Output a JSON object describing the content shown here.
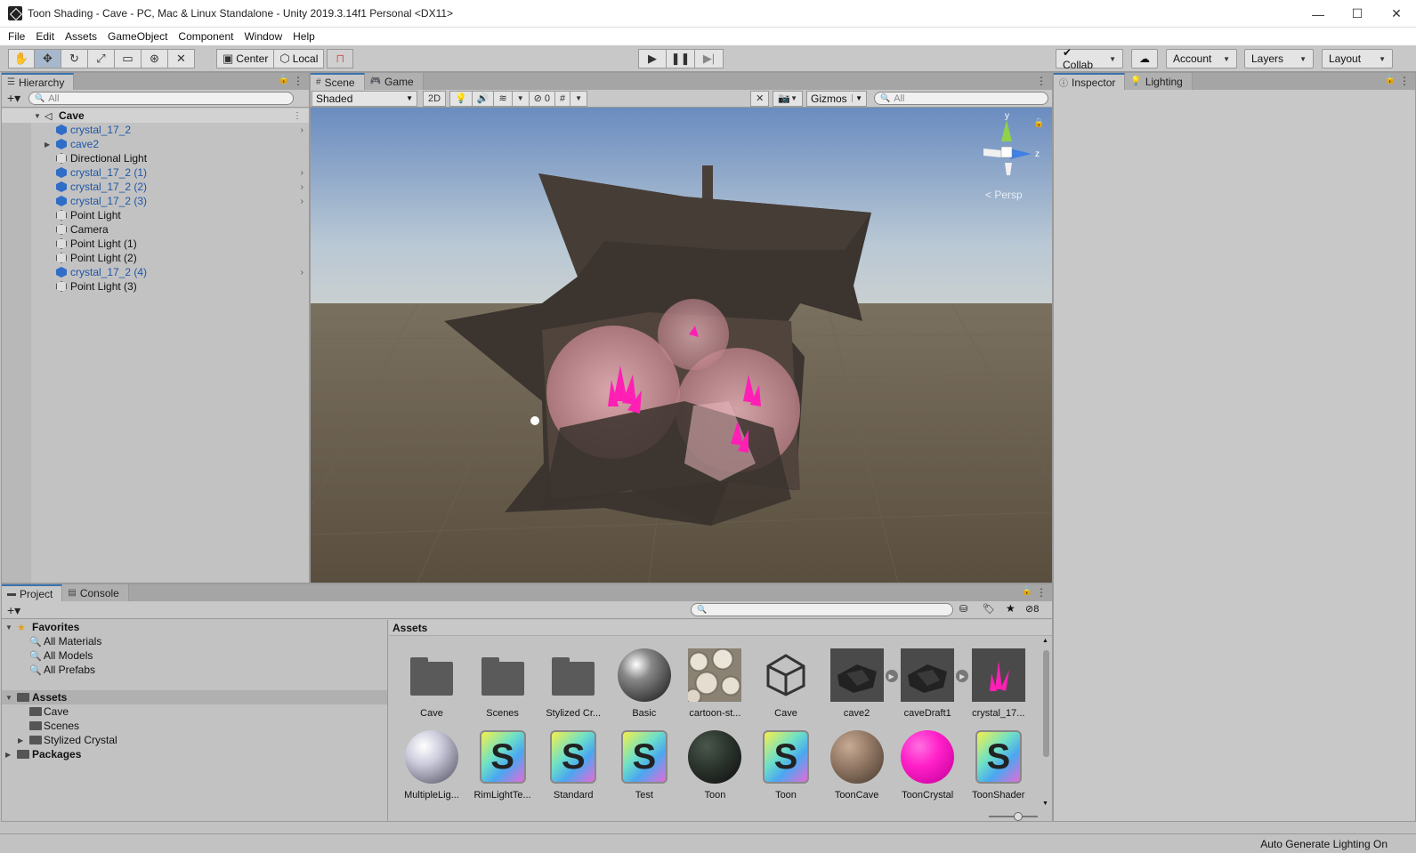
{
  "window": {
    "title": "Toon Shading - Cave - PC, Mac & Linux Standalone - Unity 2019.3.14f1 Personal <DX11>",
    "minimize": "—",
    "maximize": "☐",
    "close": "✕"
  },
  "menu": [
    "File",
    "Edit",
    "Assets",
    "GameObject",
    "Component",
    "Window",
    "Help"
  ],
  "toolbar": {
    "pivot_label": "Center",
    "space_label": "Local",
    "collab_label": "Collab",
    "account_label": "Account",
    "layers_label": "Layers",
    "layout_label": "Layout"
  },
  "hierarchy": {
    "tab_label": "Hierarchy",
    "search_placeholder": "All",
    "scene_name": "Cave",
    "items": [
      {
        "label": "crystal_17_2",
        "style": "prefab",
        "expandable": false,
        "chevron": true
      },
      {
        "label": "cave2",
        "style": "prefab",
        "expandable": true,
        "chevron": false
      },
      {
        "label": "Directional Light",
        "style": "object",
        "expandable": false,
        "chevron": false
      },
      {
        "label": "crystal_17_2 (1)",
        "style": "prefab",
        "expandable": false,
        "chevron": true
      },
      {
        "label": "crystal_17_2 (2)",
        "style": "prefab",
        "expandable": false,
        "chevron": true
      },
      {
        "label": "crystal_17_2 (3)",
        "style": "prefab",
        "expandable": false,
        "chevron": true
      },
      {
        "label": "Point Light",
        "style": "object",
        "expandable": false,
        "chevron": false
      },
      {
        "label": "Camera",
        "style": "object",
        "expandable": false,
        "chevron": false
      },
      {
        "label": "Point Light (1)",
        "style": "object",
        "expandable": false,
        "chevron": false
      },
      {
        "label": "Point Light (2)",
        "style": "object",
        "expandable": false,
        "chevron": false
      },
      {
        "label": "crystal_17_2 (4)",
        "style": "prefab",
        "expandable": false,
        "chevron": true
      },
      {
        "label": "Point Light (3)",
        "style": "object",
        "expandable": false,
        "chevron": false
      }
    ]
  },
  "scene": {
    "tabs": [
      {
        "label": "Scene",
        "icon": "grid-icon"
      },
      {
        "label": "Game",
        "icon": "gamepad-icon"
      }
    ],
    "shading_mode": "Shaded",
    "mode_2d": "2D",
    "hidden_count": "0",
    "gizmos_label": "Gizmos",
    "search_placeholder": "All",
    "gizmo_persp": "Persp",
    "axis_y": "y",
    "axis_z": "z"
  },
  "inspector": {
    "tabs": [
      {
        "label": "Inspector",
        "icon": "info-icon"
      },
      {
        "label": "Lighting",
        "icon": "bulb-icon"
      }
    ]
  },
  "project": {
    "tabs": [
      {
        "label": "Project",
        "icon": "folder-icon"
      },
      {
        "label": "Console",
        "icon": "console-icon"
      }
    ],
    "hidden_count": "8",
    "favorites_label": "Favorites",
    "favorites": [
      "All Materials",
      "All Models",
      "All Prefabs"
    ],
    "assets_label": "Assets",
    "asset_folders": [
      "Cave",
      "Scenes",
      "Stylized Crystal"
    ],
    "packages_label": "Packages",
    "grid_header": "Assets",
    "assets_row1": [
      {
        "label": "Cave",
        "kind": "folder"
      },
      {
        "label": "Scenes",
        "kind": "folder"
      },
      {
        "label": "Stylized Cr...",
        "kind": "folder"
      },
      {
        "label": "Basic",
        "kind": "material-grey"
      },
      {
        "label": "cartoon-st...",
        "kind": "texture"
      },
      {
        "label": "Cave",
        "kind": "unity-scene"
      },
      {
        "label": "cave2",
        "kind": "model"
      },
      {
        "label": "caveDraft1",
        "kind": "model"
      },
      {
        "label": "crystal_17...",
        "kind": "crystal"
      }
    ],
    "assets_row2": [
      {
        "label": "MultipleLig...",
        "kind": "material-white"
      },
      {
        "label": "RimLightTe...",
        "kind": "shader"
      },
      {
        "label": "Standard",
        "kind": "shader"
      },
      {
        "label": "Test",
        "kind": "shader"
      },
      {
        "label": "Toon",
        "kind": "material-dark"
      },
      {
        "label": "Toon",
        "kind": "shader"
      },
      {
        "label": "ToonCave",
        "kind": "material-brown"
      },
      {
        "label": "ToonCrystal",
        "kind": "material-magenta"
      },
      {
        "label": "ToonShader",
        "kind": "shader"
      }
    ]
  },
  "status": {
    "text": "Auto Generate Lighting On"
  },
  "colors": {
    "accent": "#3a72b0",
    "prefab_text": "#1e56a8",
    "crystal": "#ff1fb4",
    "sky_top": "#6f8fbf",
    "ground": "#5f5442"
  }
}
